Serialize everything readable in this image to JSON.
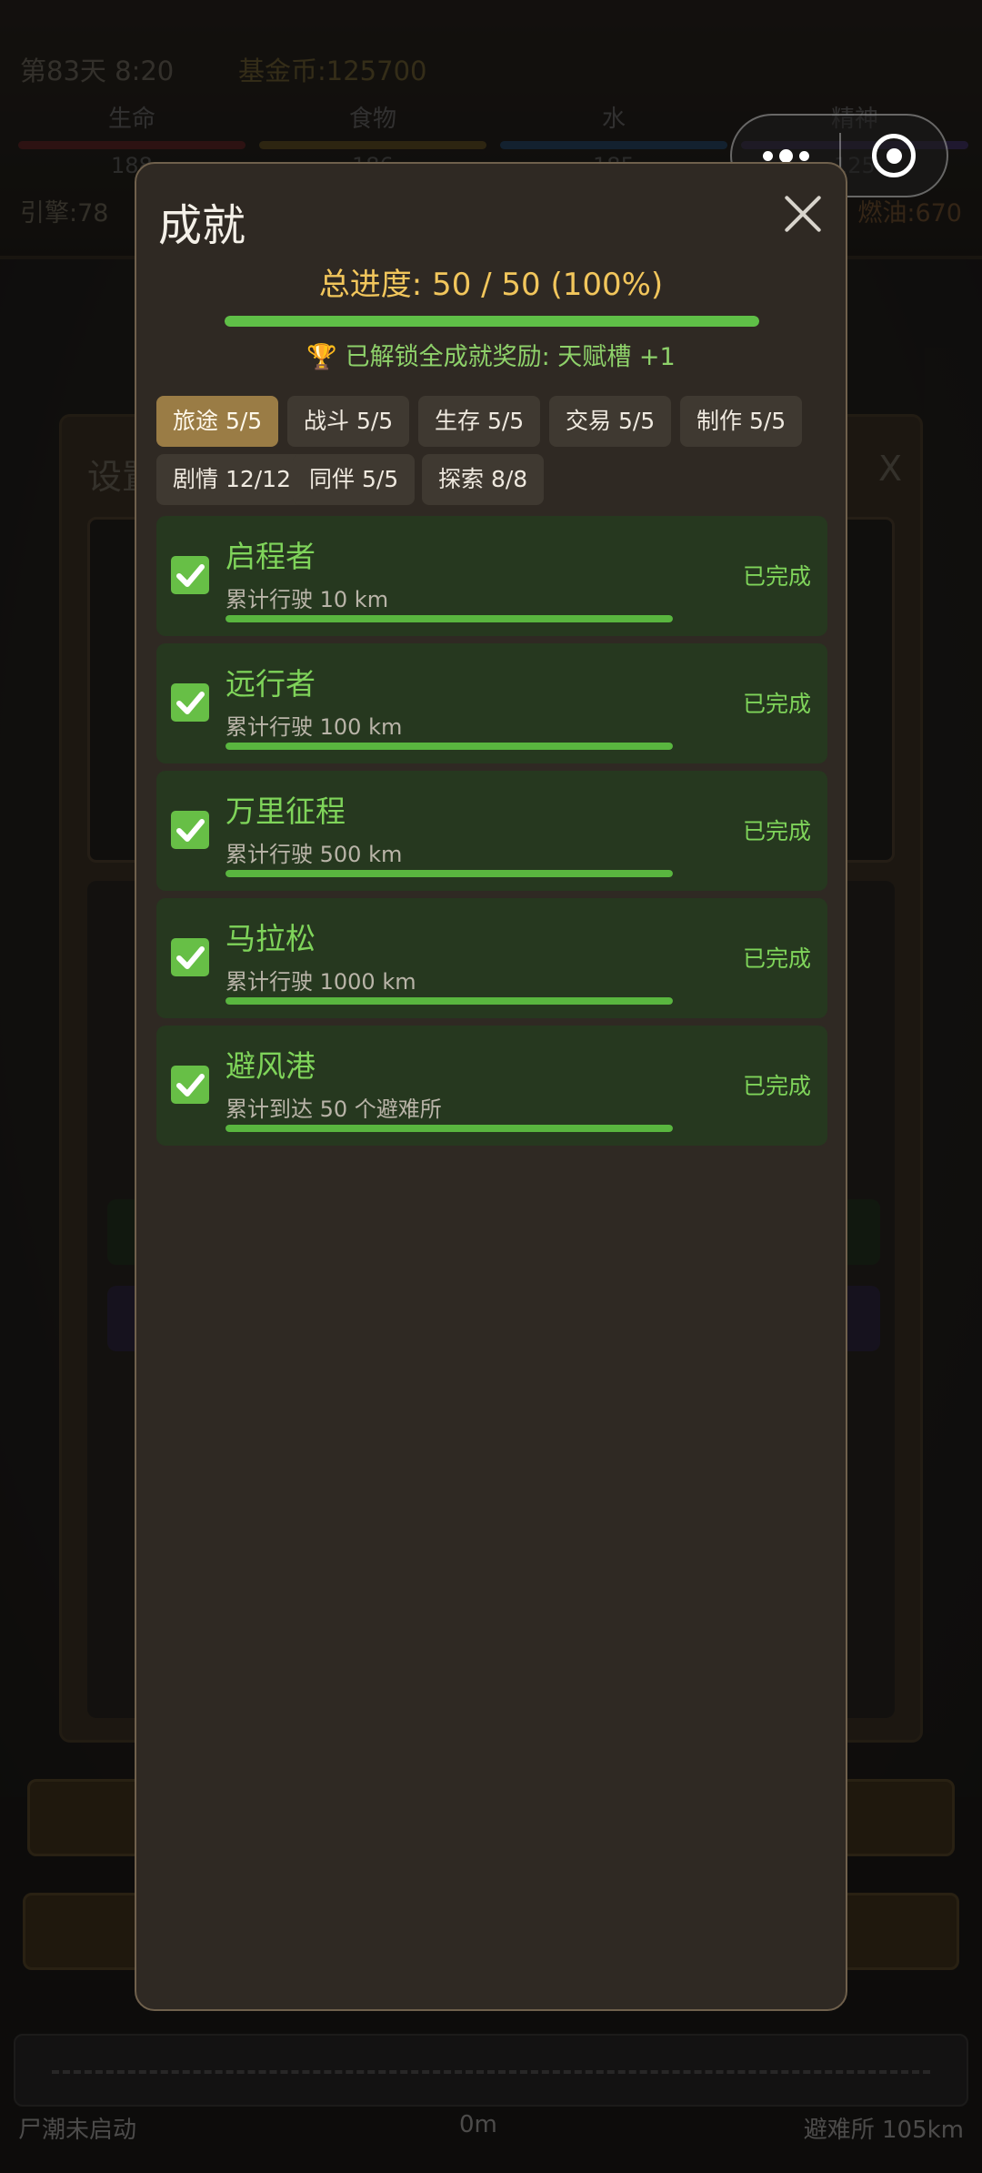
{
  "background": {
    "day_time": "第83天 8:20",
    "coins": "基金币:125700",
    "stats": [
      {
        "label": "生命",
        "value": "188",
        "color": "#c8343c"
      },
      {
        "label": "食物",
        "value": "186",
        "color": "#c9a034"
      },
      {
        "label": "水",
        "value": "185",
        "color": "#3a8ad8"
      },
      {
        "label": "精神",
        "value": "125",
        "color": "#7a5ad8"
      }
    ],
    "engine": "引擎:78",
    "fuel": "燃油:670",
    "settings_title": "设置",
    "settings_close": "X",
    "track": {
      "left_label": "尸潮未启动",
      "center_label": "0m",
      "right_label": "避难所 105km"
    }
  },
  "capsule": {
    "more_icon": "more-dots-icon",
    "close_icon": "target-close-icon"
  },
  "modal": {
    "title": "成就",
    "close_icon": "close-x-icon",
    "progress_text": "总进度: 50 / 50 (100%)",
    "progress": 1.0,
    "reward_icon": "🏆",
    "reward_text": "已解锁全成就奖励: 天赋槽 +1",
    "tabs": [
      {
        "label": "旅途 5/5",
        "active": true
      },
      {
        "label": "战斗 5/5",
        "active": false
      },
      {
        "label": "生存 5/5",
        "active": false
      },
      {
        "label": "交易 5/5",
        "active": false
      },
      {
        "label": "制作 5/5",
        "active": false
      },
      {
        "label": "剧情 12/12",
        "active": false
      },
      {
        "label": "同伴 5/5",
        "active": false
      },
      {
        "label": "探索 8/8",
        "active": false
      }
    ],
    "achievements": [
      {
        "name": "启程者",
        "desc": "累计行驶 10 km",
        "status": "已完成",
        "progress": 1.0
      },
      {
        "name": "远行者",
        "desc": "累计行驶 100 km",
        "status": "已完成",
        "progress": 1.0
      },
      {
        "name": "万里征程",
        "desc": "累计行驶 500 km",
        "status": "已完成",
        "progress": 1.0
      },
      {
        "name": "马拉松",
        "desc": "累计行驶 1000 km",
        "status": "已完成",
        "progress": 1.0
      },
      {
        "name": "避风港",
        "desc": "累计到达 50 个避难所",
        "status": "已完成",
        "progress": 1.0
      }
    ]
  },
  "colors": {
    "accent_green": "#67bf46",
    "gold": "#f2c65c",
    "active_tab": "#9a7c45"
  }
}
